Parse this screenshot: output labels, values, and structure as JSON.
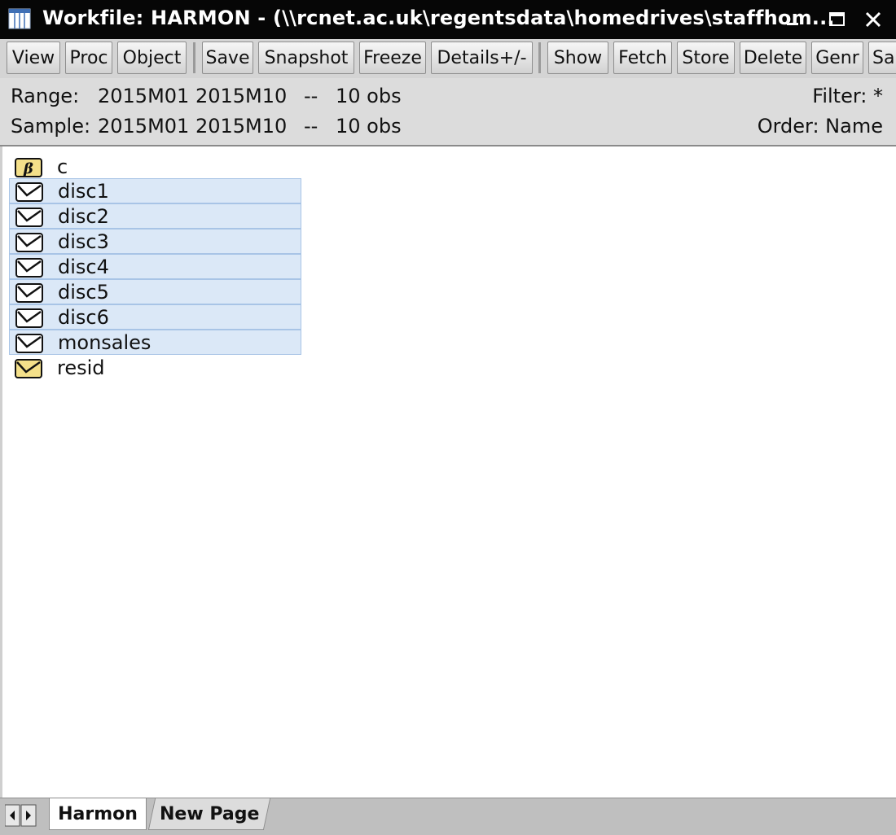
{
  "window": {
    "title": "Workfile: HARMON - (\\\\rcnet.ac.uk\\regentsdata\\homedrives\\staffhom...",
    "icon": "workfile-grid-icon"
  },
  "toolbar": {
    "view": "View",
    "proc": "Proc",
    "object": "Object",
    "save": "Save",
    "snapshot": "Snapshot",
    "freeze": "Freeze",
    "details": "Details+/-",
    "show": "Show",
    "fetch": "Fetch",
    "store": "Store",
    "delete": "Delete",
    "genr": "Genr",
    "sample": "Sa"
  },
  "info": {
    "range_label": "Range:",
    "range_value": "2015M01 2015M10",
    "range_sep": "--",
    "range_obs": "10 obs",
    "filter": "Filter: *",
    "sample_label": "Sample:",
    "sample_value": "2015M01 2015M10",
    "sample_sep": "--",
    "sample_obs": "10 obs",
    "order": "Order: Name"
  },
  "objects": [
    {
      "name": "c",
      "icon": "coefficient-beta-icon",
      "selected": false
    },
    {
      "name": "disc1",
      "icon": "series-icon",
      "selected": true
    },
    {
      "name": "disc2",
      "icon": "series-icon",
      "selected": true
    },
    {
      "name": "disc3",
      "icon": "series-icon",
      "selected": true
    },
    {
      "name": "disc4",
      "icon": "series-icon",
      "selected": true
    },
    {
      "name": "disc5",
      "icon": "series-icon",
      "selected": true
    },
    {
      "name": "disc6",
      "icon": "series-icon",
      "selected": true
    },
    {
      "name": "monsales",
      "icon": "series-icon",
      "selected": true
    },
    {
      "name": "resid",
      "icon": "series-yellow-icon",
      "selected": false
    }
  ],
  "tabs": [
    {
      "label": "Harmon",
      "active": true
    },
    {
      "label": "New Page",
      "active": false
    }
  ],
  "colors": {
    "titlebar": "#060606",
    "selection": "#dbe8f7",
    "icon_yellow": "#f4e08a"
  }
}
